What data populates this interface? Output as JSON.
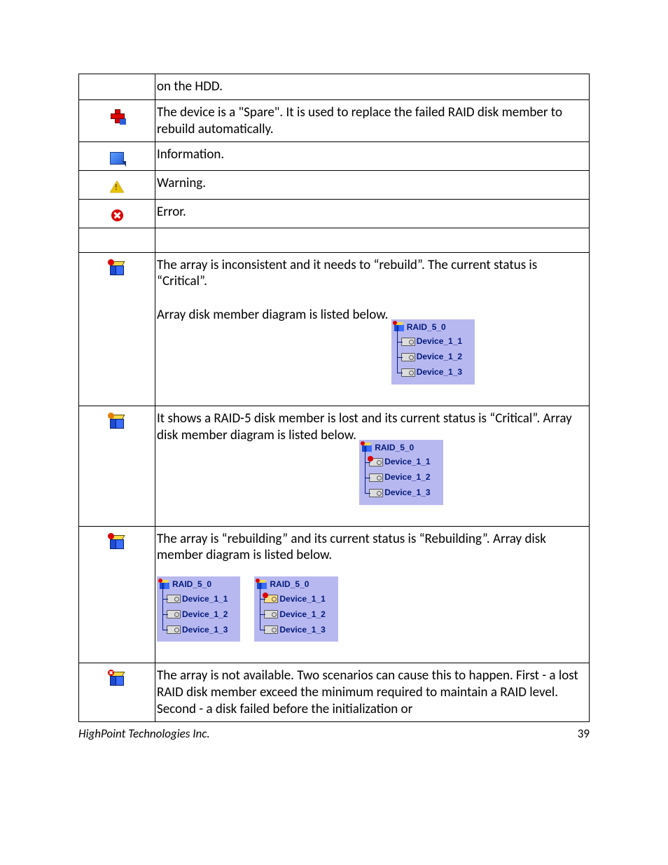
{
  "rows": {
    "r0": {
      "desc": "on the HDD."
    },
    "r1": {
      "desc": "The device is a \"Spare\". It is used to replace the failed RAID disk member to rebuild automatically."
    },
    "r2": {
      "desc": "Information."
    },
    "r3": {
      "desc": "Warning."
    },
    "r4": {
      "desc": "Error."
    },
    "r6": {
      "desc": "The array is inconsistent and it needs to “rebuild”. The current status is “Critical”.",
      "sub": "Array disk member diagram is listed below.",
      "tree_a": {
        "root": "RAID_5_0",
        "children": [
          "Device_1_1",
          "Device_1_2",
          "Device_1_3"
        ]
      }
    },
    "r7": {
      "desc": "It shows a RAID-5 disk member is lost and its current status is “Critical”. Array disk member diagram is listed below.",
      "tree_a": {
        "root": "RAID_5_0",
        "children": [
          "Device_1_1",
          "Device_1_2",
          "Device_1_3"
        ],
        "fail_index": 0
      }
    },
    "r8": {
      "desc": "The array is “rebuilding” and its current status is “Rebuilding”. Array disk member diagram is listed below.",
      "tree_a": {
        "root": "RAID_5_0",
        "children": [
          "Device_1_1",
          "Device_1_2",
          "Device_1_3"
        ]
      },
      "tree_b": {
        "root": "RAID_5_0",
        "children": [
          "Device_1_1",
          "Device_1_2",
          "Device_1_3"
        ],
        "rebuild_index": 0
      }
    },
    "r9": {
      "desc": "The array is not available. Two scenarios can cause this to happen. First - a lost RAID disk member exceed the minimum required to maintain a RAID level. Second - a disk failed before the initialization or"
    }
  },
  "footer": {
    "company": "HighPoint Technologies Inc",
    "page": "39"
  }
}
